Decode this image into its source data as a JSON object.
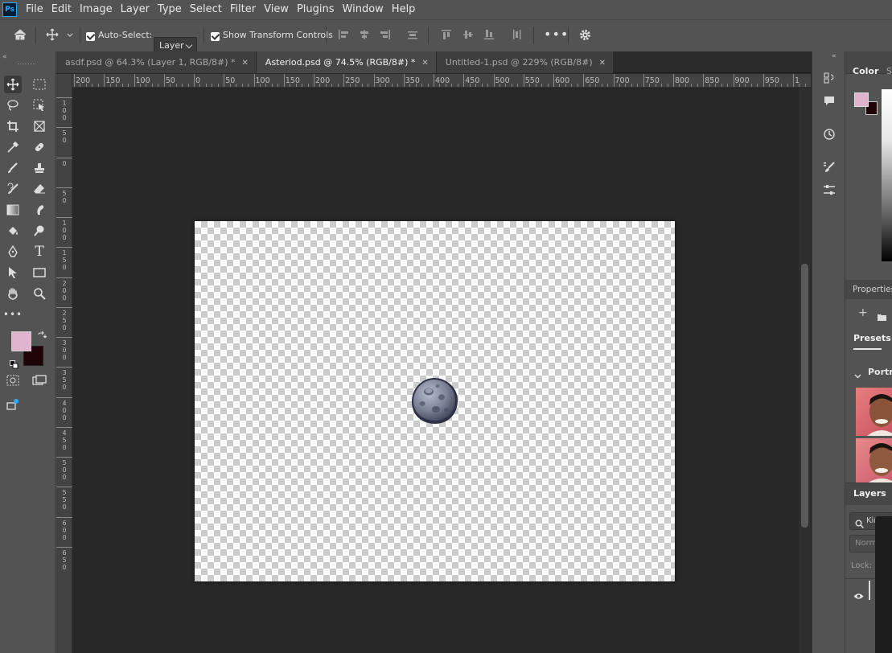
{
  "app": {
    "logo_text": "Ps"
  },
  "menu": [
    "File",
    "Edit",
    "Image",
    "Layer",
    "Type",
    "Select",
    "Filter",
    "View",
    "Plugins",
    "Window",
    "Help"
  ],
  "options_bar": {
    "auto_select_label": "Auto-Select:",
    "auto_select_checked": true,
    "layer_select_value": "Layer",
    "show_transform_label": "Show Transform Controls",
    "show_transform_checked": true
  },
  "tabs": [
    {
      "label": "asdf.psd @ 64.3% (Layer 1, RGB/8#) *",
      "active": false
    },
    {
      "label": "Asteriod.psd @ 74.5% (RGB/8#) *",
      "active": true
    },
    {
      "label": "Untitled-1.psd @ 229% (RGB/8#)",
      "active": false
    }
  ],
  "ruler_h_labels": [
    "200",
    "150",
    "100",
    "50",
    "0",
    "50",
    "100",
    "150",
    "200",
    "250",
    "300",
    "350",
    "400",
    "450",
    "500",
    "550",
    "600",
    "650",
    "700",
    "750",
    "800",
    "850",
    "900",
    "950",
    "1"
  ],
  "ruler_v_labels": [
    "100",
    "50",
    "0",
    "50",
    "100",
    "150",
    "200",
    "250",
    "300",
    "350",
    "400",
    "450",
    "500",
    "550",
    "600",
    "650"
  ],
  "colors": {
    "foreground": "#e0b3cf",
    "background": "#1e0406",
    "accent": "#31a8ff"
  },
  "right_panels": {
    "color_tab": "Color",
    "color_tab_2": "Sw",
    "properties_title": "Properties",
    "presets_tab": "Presets",
    "presets_group": "Portra",
    "layers_tab": "Layers",
    "layers_search": "Kin",
    "blend_mode": "Norm",
    "lock_label": "Lock:"
  }
}
